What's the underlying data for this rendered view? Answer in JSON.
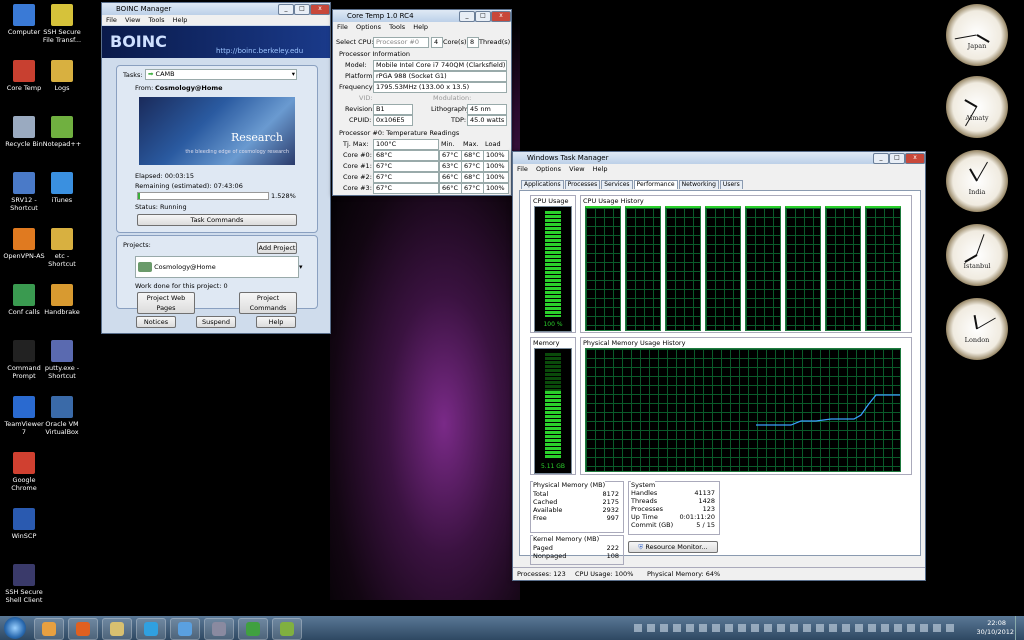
{
  "desktop_icons": [
    {
      "label": "Computer",
      "color": "#3a7ad6"
    },
    {
      "label": "SSH Secure File Transf...",
      "color": "#d6c23a"
    },
    {
      "label": "Core Temp",
      "color": "#c84030"
    },
    {
      "label": "Logs",
      "color": "#d8b040"
    },
    {
      "label": "Recycle Bin",
      "color": "#9aaac0"
    },
    {
      "label": "Notepad++",
      "color": "#70b040"
    },
    {
      "label": "SRV12 - Shortcut",
      "color": "#4a7ac8"
    },
    {
      "label": "iTunes",
      "color": "#3a90e0"
    },
    {
      "label": "OpenVPN-AS",
      "color": "#e07a20"
    },
    {
      "label": "etc - Shortcut",
      "color": "#d8b040"
    },
    {
      "label": "Conf calls",
      "color": "#3a9a50"
    },
    {
      "label": "Handbrake",
      "color": "#d89a30"
    },
    {
      "label": "Command Prompt",
      "color": "#222222"
    },
    {
      "label": "putty.exe - Shortcut",
      "color": "#5a6ab0"
    },
    {
      "label": "TeamViewer 7",
      "color": "#2a6ad0"
    },
    {
      "label": "Oracle VM VirtualBox",
      "color": "#3a6aa8"
    },
    {
      "label": "Google Chrome",
      "color": "#d04030"
    },
    {
      "label": "WinSCP",
      "color": "#2a5ab0"
    },
    {
      "label": "SSH Secure Shell Client",
      "color": "#3a3a6a"
    }
  ],
  "boinc": {
    "title": "BOINC Manager",
    "menu": [
      "File",
      "View",
      "Tools",
      "Help"
    ],
    "logo": "BOINC",
    "url": "http://boinc.berkeley.edu",
    "tasks_label": "Tasks:",
    "task_selected": "CAMB",
    "from_label": "From:",
    "from_value": "Cosmology@Home",
    "banner_text": "Research",
    "banner_sub": "the bleeding edge of cosmology research",
    "elapsed": "Elapsed: 00:03:15",
    "remaining": "Remaining (estimated): 07:43:06",
    "progress_pct": "1.528%",
    "progress_fraction": 0.01528,
    "status": "Status: Running",
    "task_commands": "Task Commands",
    "projects_label": "Projects:",
    "add_project": "Add Project",
    "project_selected": "Cosmology@Home",
    "work_done": "Work done for this project: 0",
    "project_web": "Project Web Pages",
    "project_commands": "Project Commands",
    "notices": "Notices",
    "suspend": "Suspend",
    "help": "Help"
  },
  "coretemp": {
    "title": "Core Temp 1.0 RC4",
    "menu": [
      "File",
      "Options",
      "Tools",
      "Help"
    ],
    "select_cpu_label": "Select CPU:",
    "select_cpu_value": "Processor #0",
    "cores_count": "4",
    "cores_label": "Core(s)",
    "threads_count": "8",
    "threads_label": "Thread(s)",
    "proc_info_label": "Processor Information",
    "model_label": "Model:",
    "model": "Mobile Intel Core i7 740QM (Clarksfield)",
    "platform_label": "Platform:",
    "platform": "rPGA 988 (Socket G1)",
    "frequency_label": "Frequency:",
    "frequency": "1795.53MHz (133.00 x 13.5)",
    "vid_label": "VID:",
    "modulation_label": "Modulation:",
    "revision_label": "Revision:",
    "revision": "B1",
    "lithography_label": "Lithography:",
    "lithography": "45 nm",
    "cpuid_label": "CPUID:",
    "cpuid": "0x106E5",
    "tdp_label": "TDP:",
    "tdp": "45.0 watts",
    "temp_label": "Processor #0: Temperature Readings",
    "headers": [
      "Tj. Max:",
      "100°C",
      "Min.",
      "Max.",
      "Load"
    ],
    "cores": [
      {
        "name": "Core #0:",
        "temp": "68°C",
        "min": "67°C",
        "max": "68°C",
        "load": "100%"
      },
      {
        "name": "Core #1:",
        "temp": "67°C",
        "min": "63°C",
        "max": "67°C",
        "load": "100%"
      },
      {
        "name": "Core #2:",
        "temp": "67°C",
        "min": "66°C",
        "max": "68°C",
        "load": "100%"
      },
      {
        "name": "Core #3:",
        "temp": "67°C",
        "min": "66°C",
        "max": "67°C",
        "load": "100%"
      }
    ]
  },
  "taskmgr": {
    "title": "Windows Task Manager",
    "menu": [
      "File",
      "Options",
      "View",
      "Help"
    ],
    "tabs": [
      "Applications",
      "Processes",
      "Services",
      "Performance",
      "Networking",
      "Users"
    ],
    "active_tab": "Performance",
    "cpu_usage_label": "CPU Usage",
    "cpu_usage_value": "100 %",
    "cpu_history_label": "CPU Usage History",
    "memory_label": "Memory",
    "memory_value": "5.11 GB",
    "phys_history_label": "Physical Memory Usage History",
    "phys_mem_label": "Physical Memory (MB)",
    "phys_mem": [
      [
        "Total",
        "8172"
      ],
      [
        "Cached",
        "2175"
      ],
      [
        "Available",
        "2932"
      ],
      [
        "Free",
        "997"
      ]
    ],
    "kernel_label": "Kernel Memory (MB)",
    "kernel": [
      [
        "Paged",
        "222"
      ],
      [
        "Nonpaged",
        "108"
      ]
    ],
    "system_label": "System",
    "system": [
      [
        "Handles",
        "41137"
      ],
      [
        "Threads",
        "1428"
      ],
      [
        "Processes",
        "123"
      ],
      [
        "Up Time",
        "0:01:11:20"
      ],
      [
        "Commit (GB)",
        "5 / 15"
      ]
    ],
    "resource_monitor": "Resource Monitor...",
    "status_processes": "Processes: 123",
    "status_cpu": "CPU Usage: 100%",
    "status_mem": "Physical Memory: 64%"
  },
  "clocks": [
    {
      "label": "Japan"
    },
    {
      "label": "Almaty"
    },
    {
      "label": "India"
    },
    {
      "label": "Istanbul"
    },
    {
      "label": "London"
    }
  ],
  "tray": {
    "time": "22:08",
    "date": "30/10/2012"
  }
}
